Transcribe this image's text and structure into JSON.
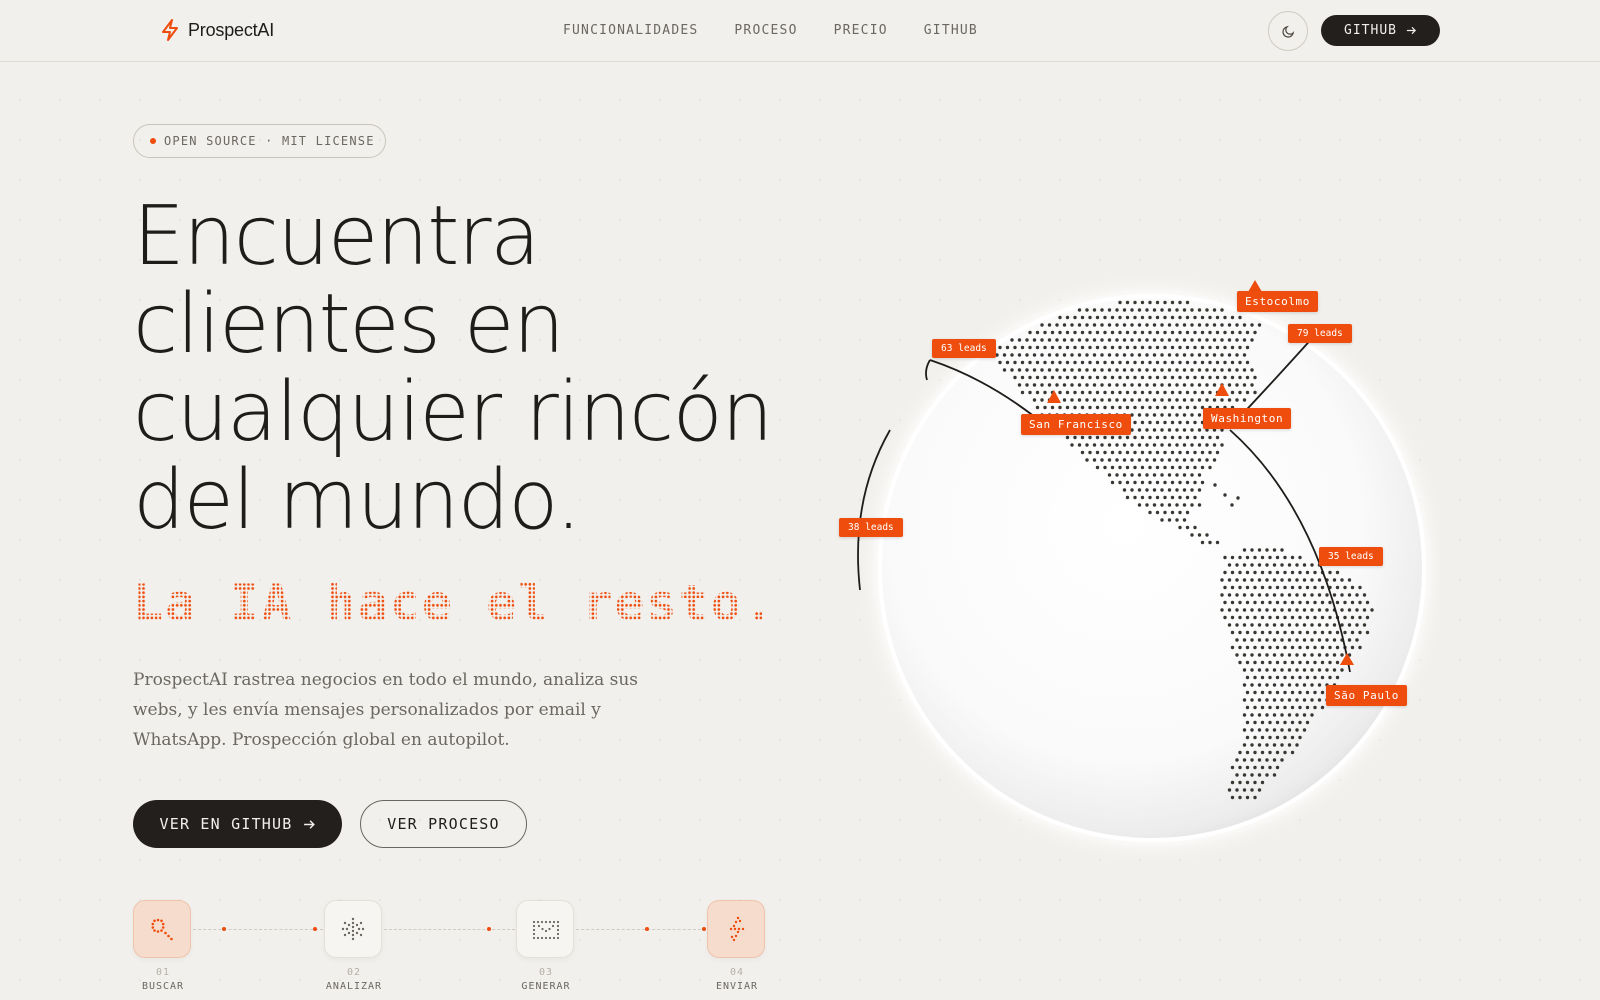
{
  "brand": {
    "name": "ProspectAI",
    "accent": "#ee4d0d",
    "dark": "#221f1c"
  },
  "nav": {
    "links": [
      "FUNCIONALIDADES",
      "PROCESO",
      "PRECIO",
      "GITHUB"
    ],
    "theme_icon": "moon-icon",
    "github_label": "GITHUB"
  },
  "hero": {
    "badge": "OPEN SOURCE · MIT LICENSE",
    "headline_lines": [
      "Encuentra",
      "clientes en",
      "cualquier rincón",
      "del mundo."
    ],
    "tagline": "La IA hace el resto.",
    "description": "ProspectAI rastrea negocios en todo el mundo, analiza sus webs, y les envía mensajes personalizados por email y WhatsApp. Prospección global en autopilot.",
    "primary_cta": "VER EN GITHUB",
    "secondary_cta": "VER PROCESO"
  },
  "steps": [
    {
      "num": "01",
      "label": "BUSCAR",
      "icon": "search-icon"
    },
    {
      "num": "02",
      "label": "ANALIZAR",
      "icon": "sparkle-icon"
    },
    {
      "num": "03",
      "label": "GENERAR",
      "icon": "envelope-icon"
    },
    {
      "num": "04",
      "label": "ENVIAR",
      "icon": "lightning-icon"
    }
  ],
  "globe": {
    "cities": [
      "Estocolmo",
      "San Francisco",
      "Washington",
      "São Paulo"
    ],
    "leads": [
      "63 leads",
      "79 leads",
      "38 leads",
      "35 leads"
    ]
  }
}
